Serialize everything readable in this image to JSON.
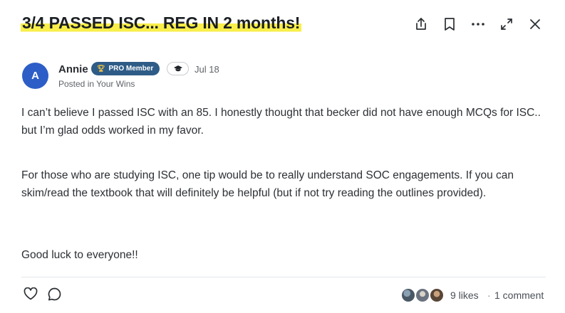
{
  "post": {
    "title": "3/4 PASSED ISC... REG IN 2 months!",
    "highlight_color": "#f9ee4a"
  },
  "header_actions": [
    {
      "icon": "share-icon"
    },
    {
      "icon": "bookmark-icon"
    },
    {
      "icon": "more-options-icon"
    },
    {
      "icon": "expand-icon"
    },
    {
      "icon": "close-icon"
    }
  ],
  "author": {
    "initial": "A",
    "name": "Annie",
    "badge_label": "PRO Member",
    "badge_icon": "trophy-icon",
    "secondary_badge_icon": "graduation-cap-icon",
    "date": "Jul 18",
    "posted_in": "Posted in Your Wins",
    "avatar_color": "#2d5ec7",
    "badge_color": "#2e5c87"
  },
  "body": {
    "paragraphs": [
      "I can’t believe I passed ISC with an 85. I honestly thought that becker did not have enough MCQs for ISC.. but I’m glad odds worked in my favor.",
      "For those who are studying ISC, one tip would be to really understand SOC engagements. If you can skim/read the textbook that will definitely be helpful (but if not try reading the outlines provided).",
      "Good luck to everyone!!"
    ]
  },
  "footer": {
    "likes": "9 likes",
    "separator": "·",
    "comments": "1 comment",
    "liker_avatar_count": 3
  }
}
